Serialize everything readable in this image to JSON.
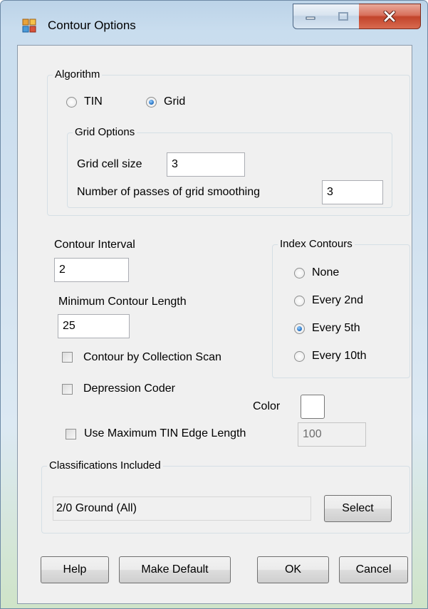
{
  "window": {
    "title": "Contour Options",
    "icon": "app-grid-icon",
    "controls": {
      "minimize": "minimize-icon",
      "maximize": "maximize-icon",
      "close": "close-icon"
    },
    "close_color": "#c7452c"
  },
  "algorithm": {
    "legend": "Algorithm",
    "options": [
      {
        "label": "TIN",
        "checked": false
      },
      {
        "label": "Grid",
        "checked": true
      }
    ],
    "grid_options": {
      "legend": "Grid Options",
      "cell_size_label": "Grid cell size",
      "cell_size_value": "3",
      "smoothing_label": "Number of passes of grid smoothing",
      "smoothing_value": "3"
    }
  },
  "contour": {
    "interval_label": "Contour Interval",
    "interval_value": "2",
    "min_length_label": "Minimum Contour Length",
    "min_length_value": "25",
    "collection_scan_label": "Contour by Collection Scan",
    "collection_scan_checked": false,
    "depression_label": "Depression Coder",
    "depression_checked": false,
    "color_label": "Color",
    "color_value": "#ffffff",
    "max_tin_label": "Use Maximum TIN Edge Length",
    "max_tin_checked": false,
    "max_tin_value": "100"
  },
  "index_contours": {
    "legend": "Index Contours",
    "options": [
      {
        "label": "None",
        "checked": false
      },
      {
        "label": "Every 2nd",
        "checked": false
      },
      {
        "label": "Every 5th",
        "checked": true
      },
      {
        "label": "Every 10th",
        "checked": false
      }
    ]
  },
  "classifications": {
    "legend": "Classifications Included",
    "value": "2/0 Ground (All)",
    "select_label": "Select"
  },
  "buttons": {
    "help": "Help",
    "make_default": "Make Default",
    "ok": "OK",
    "cancel": "Cancel"
  }
}
